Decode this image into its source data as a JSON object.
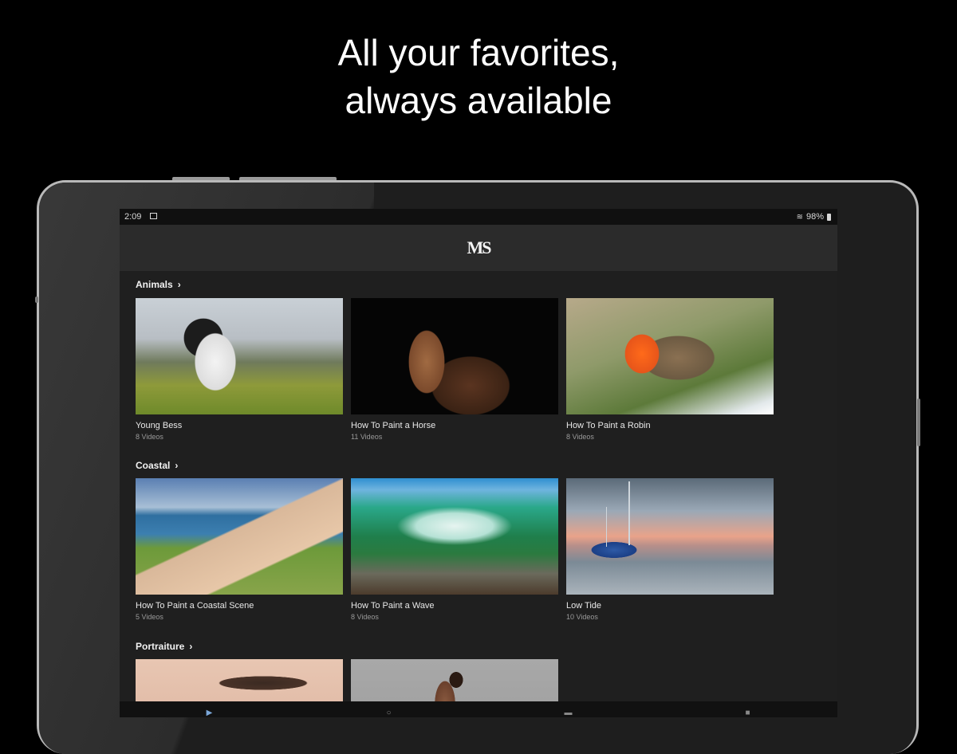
{
  "headline": {
    "line1": "All your favorites,",
    "line2": "always available"
  },
  "status_bar": {
    "time": "2:09",
    "battery": "98%",
    "icons": [
      "image-icon",
      "wifi-icon",
      "battery-icon"
    ]
  },
  "app_bar": {
    "logo": "MS"
  },
  "sections": [
    {
      "title": "Animals",
      "cards": [
        {
          "title": "Young Bess",
          "subtitle": "8 Videos"
        },
        {
          "title": "How To Paint a Horse",
          "subtitle": "11 Videos"
        },
        {
          "title": "How To Paint a Robin",
          "subtitle": "8 Videos"
        }
      ]
    },
    {
      "title": "Coastal",
      "cards": [
        {
          "title": "How To Paint a Coastal Scene",
          "subtitle": "5 Videos"
        },
        {
          "title": "How To Paint a Wave",
          "subtitle": "8 Videos"
        },
        {
          "title": "Low Tide",
          "subtitle": "10 Videos"
        }
      ]
    },
    {
      "title": "Portraiture",
      "cards": [
        {
          "title": "",
          "subtitle": ""
        },
        {
          "title": "",
          "subtitle": ""
        }
      ]
    }
  ],
  "bottom_nav": {
    "items": [
      "play-icon",
      "search-icon",
      "menu-icon",
      "profile-icon"
    ],
    "active": 0
  },
  "colors": {
    "background": "#000000",
    "screen": "#1f1f1f",
    "app_bar": "#2b2b2b",
    "accent": "#7aa6d8"
  }
}
